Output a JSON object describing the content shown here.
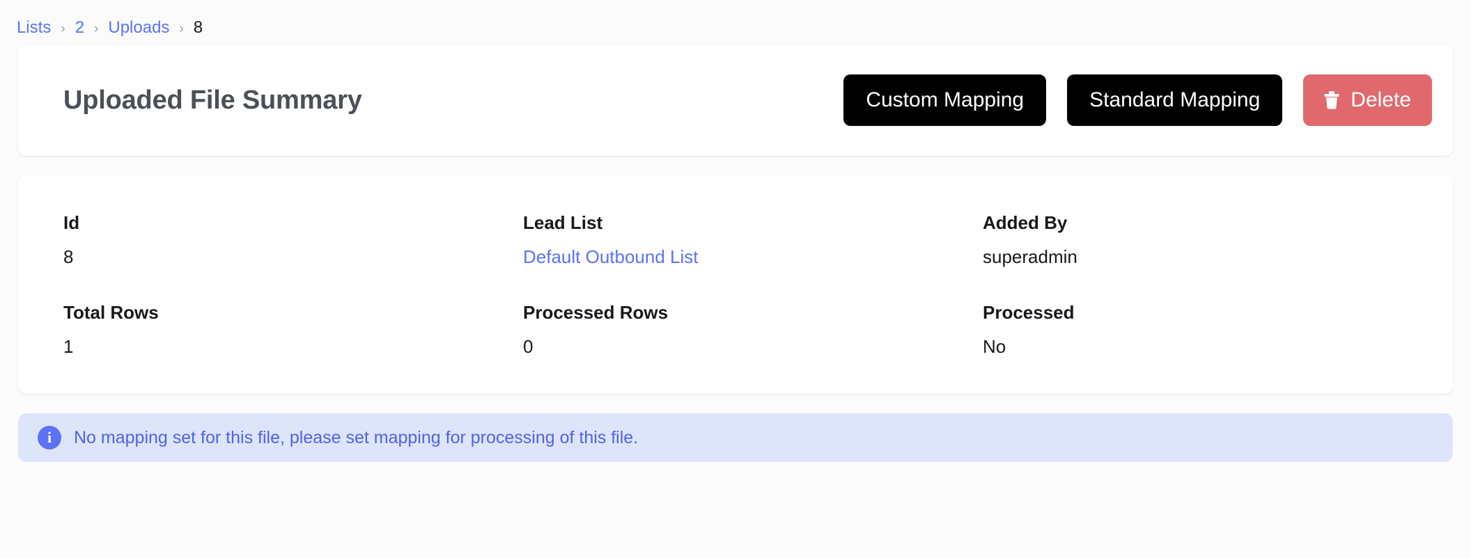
{
  "breadcrumb": {
    "separator": "›",
    "items": [
      {
        "label": "Lists",
        "type": "link"
      },
      {
        "label": "2",
        "type": "link"
      },
      {
        "label": "Uploads",
        "type": "link"
      },
      {
        "label": "8",
        "type": "current"
      }
    ]
  },
  "header": {
    "title": "Uploaded File Summary",
    "actions": {
      "custom_mapping_label": "Custom Mapping",
      "standard_mapping_label": "Standard Mapping",
      "delete_label": "Delete",
      "delete_icon": "trash-icon"
    }
  },
  "details": {
    "fields": [
      {
        "label": "Id",
        "value": "8",
        "is_link": false
      },
      {
        "label": "Lead List",
        "value": "Default Outbound List",
        "is_link": true
      },
      {
        "label": "Added By",
        "value": "superadmin",
        "is_link": false
      },
      {
        "label": "Total Rows",
        "value": "1",
        "is_link": false
      },
      {
        "label": "Processed Rows",
        "value": "0",
        "is_link": false
      },
      {
        "label": "Processed",
        "value": "No",
        "is_link": false
      }
    ]
  },
  "alert": {
    "icon": "info-icon",
    "icon_glyph": "i",
    "message": "No mapping set for this file, please set mapping for processing of this file."
  },
  "colors": {
    "link_blue": "#5b72f2",
    "alert_bg": "#dde5fb",
    "alert_text": "#4f63e8",
    "danger": "#e0696e",
    "dark_button": "#000000",
    "page_bg": "#fbfbfb",
    "card_bg": "#ffffff",
    "title_gray": "#4b5057"
  }
}
